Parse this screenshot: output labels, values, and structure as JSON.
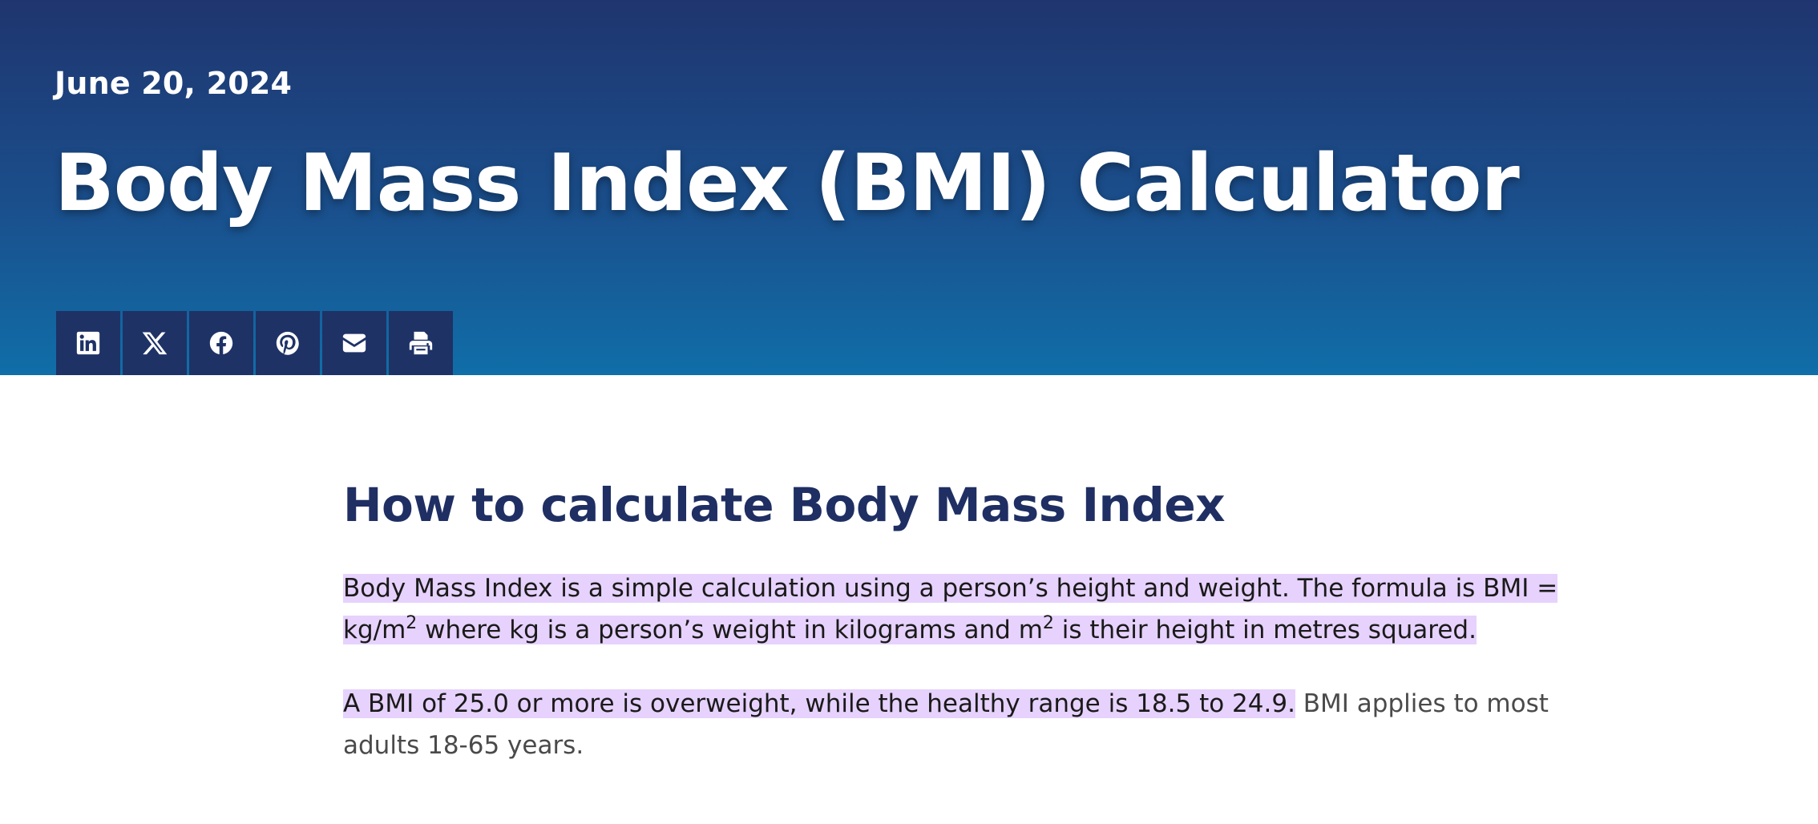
{
  "hero": {
    "date": "June 20, 2024",
    "title": "Body Mass Index (BMI) Calculator",
    "share_buttons": [
      {
        "icon": "linkedin-icon"
      },
      {
        "icon": "x-twitter-icon"
      },
      {
        "icon": "facebook-icon"
      },
      {
        "icon": "pinterest-icon"
      },
      {
        "icon": "email-icon"
      },
      {
        "icon": "print-icon"
      }
    ]
  },
  "article": {
    "heading": "How to calculate Body Mass Index",
    "p1": {
      "part1": "Body Mass Index is a simple calculation using a person’s height and weight. The formula is BMI = kg/m",
      "sup1": "2",
      "part2": " where kg is a person’s weight in kilograms and m",
      "sup2": "2",
      "part3": " is their height in metres squared."
    },
    "p2": {
      "highlighted": "A BMI of 25.0 or more is overweight, while the healthy range is 18.5 to 24.9.",
      "rest": " BMI applies to most adults 18-65 years."
    }
  },
  "colors": {
    "hero_top": "#1f356f",
    "hero_bottom": "#106ea8",
    "share_button_bg": "#1e3266",
    "heading": "#1f2f63",
    "highlight": "#e6d2fc"
  }
}
